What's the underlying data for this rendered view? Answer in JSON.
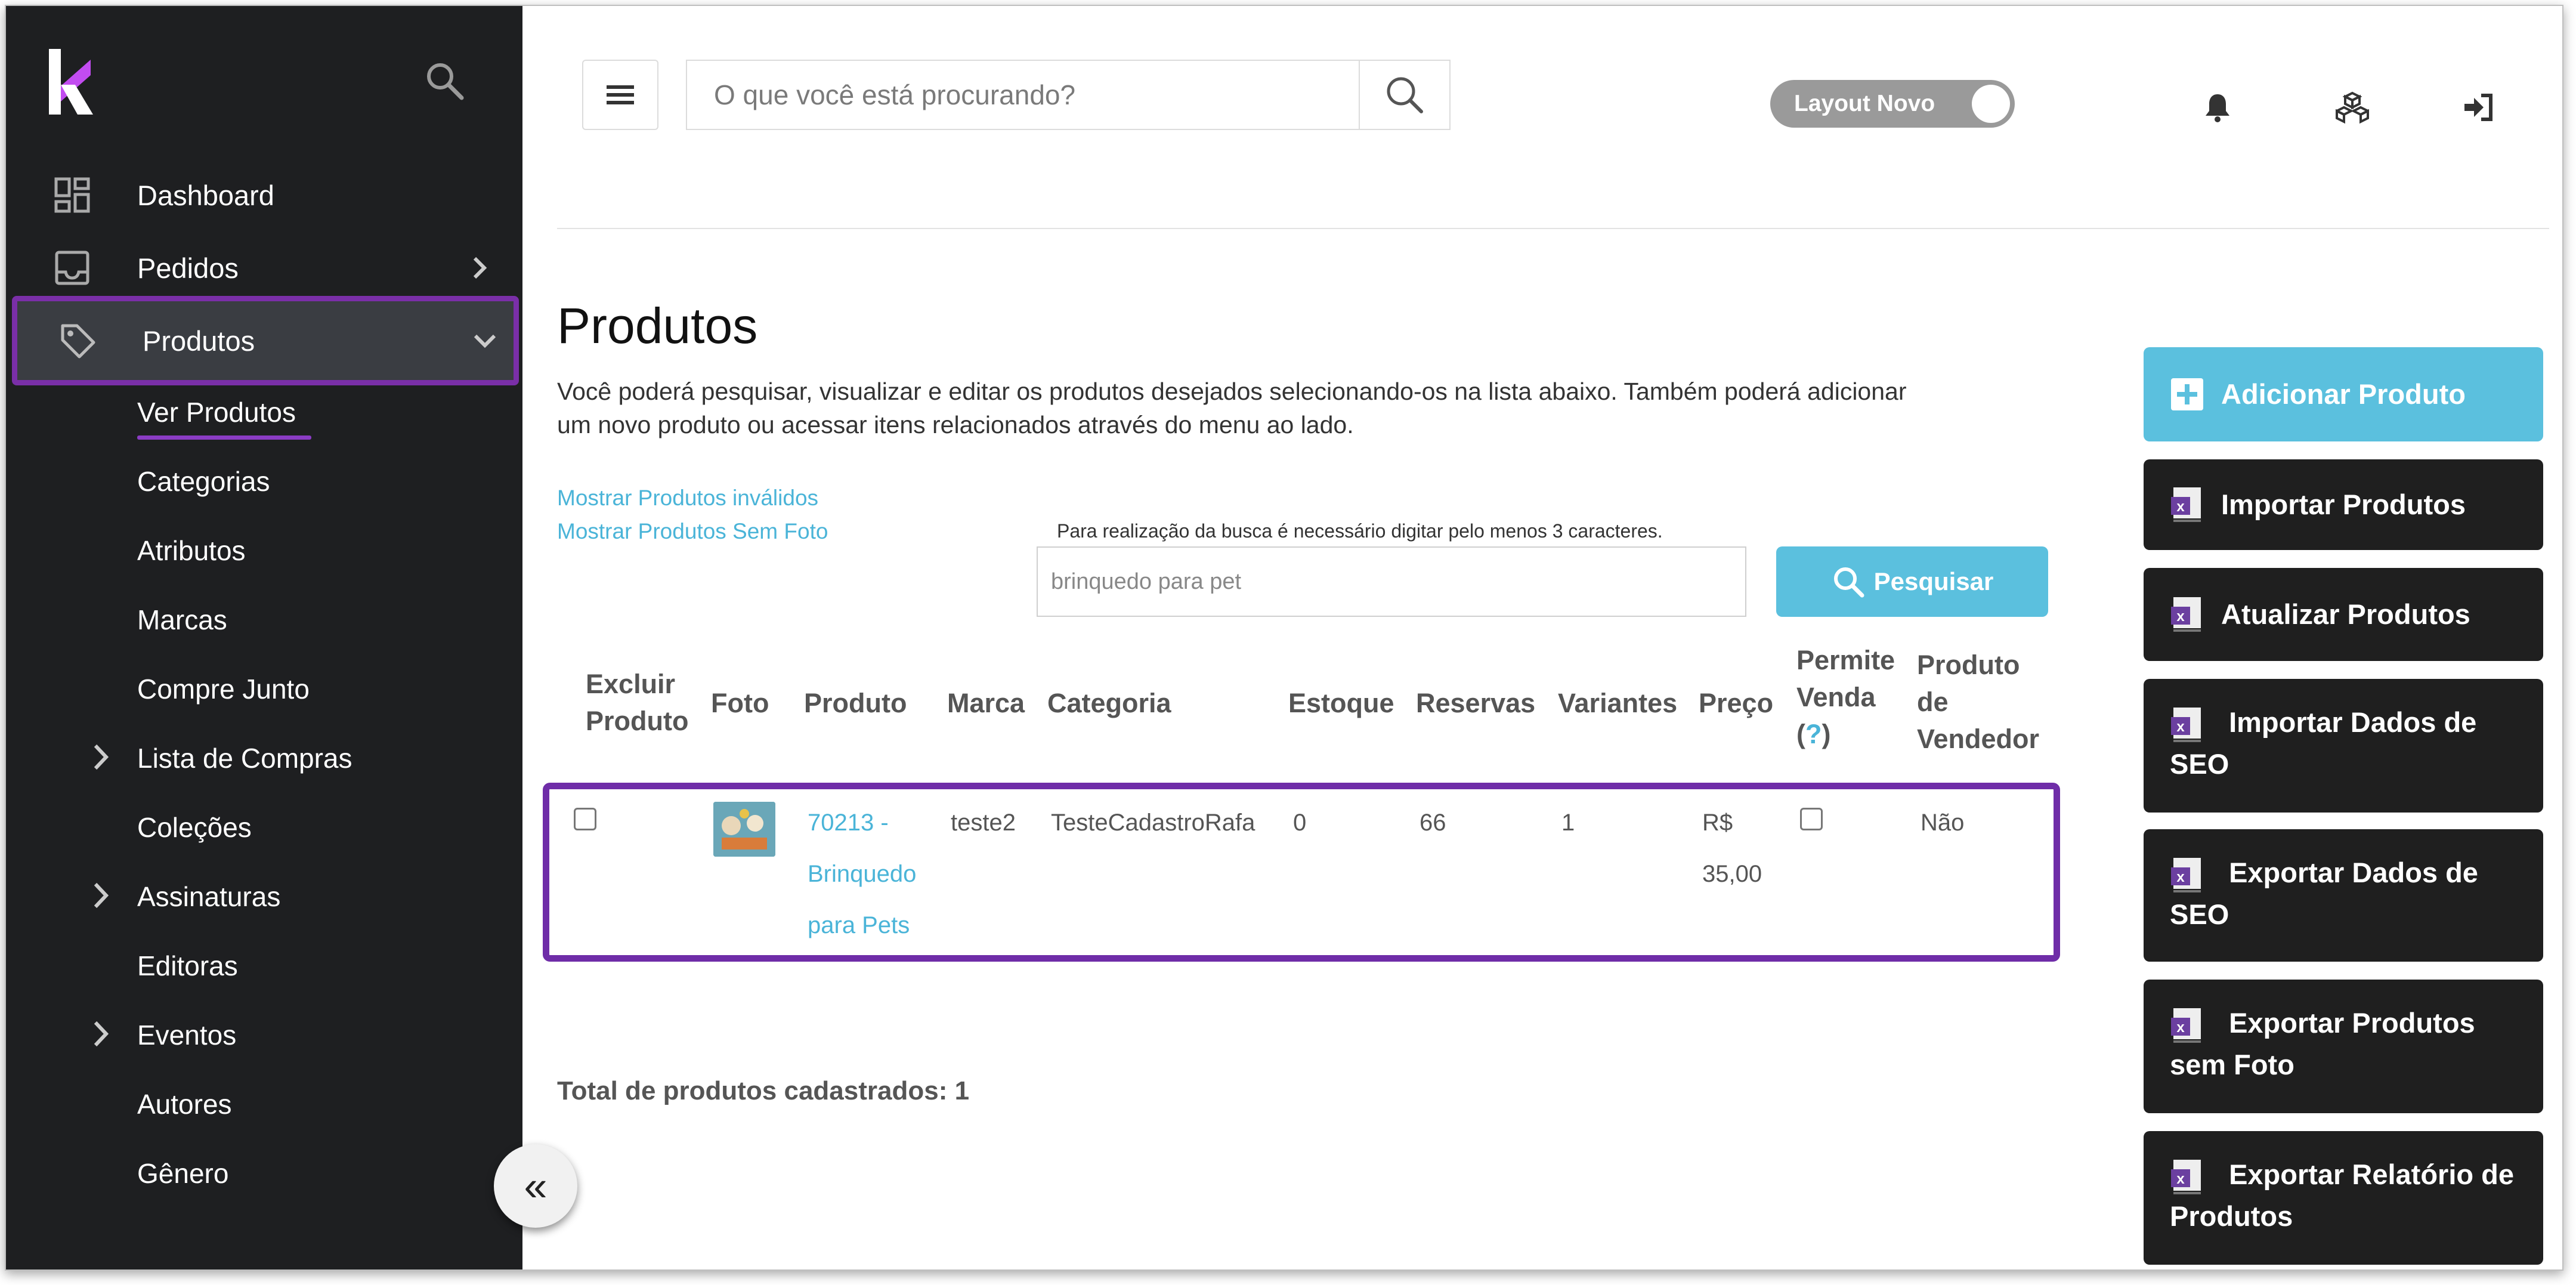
{
  "sidebar": {
    "items": [
      {
        "label": "Dashboard"
      },
      {
        "label": "Pedidos"
      },
      {
        "label": "Produtos"
      }
    ],
    "subitems": [
      {
        "label": "Ver Produtos"
      },
      {
        "label": "Categorias"
      },
      {
        "label": "Atributos"
      },
      {
        "label": "Marcas"
      },
      {
        "label": "Compre Junto"
      },
      {
        "label": "Lista de Compras"
      },
      {
        "label": "Coleções"
      },
      {
        "label": "Assinaturas"
      },
      {
        "label": "Editoras"
      },
      {
        "label": "Eventos"
      },
      {
        "label": "Autores"
      },
      {
        "label": "Gênero"
      }
    ],
    "collapse_label": "«"
  },
  "header": {
    "search_placeholder": "O que você está procurando?",
    "toggle_label": "Layout Novo"
  },
  "main": {
    "title": "Produtos",
    "description": "Você poderá pesquisar, visualizar e editar os produtos desejados selecionando-os na lista abaixo. Também poderá adicionar um novo produto ou acessar itens relacionados através do menu ao lado.",
    "link_invalid": "Mostrar Produtos inválidos",
    "link_no_photo": "Mostrar Produtos Sem Foto",
    "search_hint": "Para realização da busca é necessário digitar pelo menos 3 caracteres.",
    "search_value": "brinquedo para pet",
    "search_button": "Pesquisar",
    "table": {
      "headers": {
        "delete": [
          "Excluir",
          "Produto"
        ],
        "photo": "Foto",
        "product": "Produto",
        "brand": "Marca",
        "category": "Categoria",
        "stock": "Estoque",
        "reservations": "Reservas",
        "variants": "Variantes",
        "price": "Preço",
        "allow_sale": [
          "Permite",
          "Venda",
          "(",
          "?",
          ")"
        ],
        "seller_product": [
          "Produto",
          "de",
          "Vendedor"
        ]
      },
      "row": {
        "product_lines": [
          "70213 -",
          "Brinquedo",
          "para Pets"
        ],
        "brand": "teste2",
        "category": "TesteCadastroRafa",
        "stock": "0",
        "reservations": "66",
        "variants": "1",
        "price_lines": [
          "R$",
          "35,00"
        ],
        "seller_product": "Não"
      }
    },
    "total": "Total de produtos cadastrados: 1"
  },
  "actions": [
    {
      "lines": [
        "Adicionar Produto"
      ]
    },
    {
      "lines": [
        "Importar Produtos"
      ]
    },
    {
      "lines": [
        "Atualizar Produtos"
      ]
    },
    {
      "lines": [
        "Importar Dados de",
        "SEO"
      ]
    },
    {
      "lines": [
        "Exportar Dados de",
        "SEO"
      ]
    },
    {
      "lines": [
        "Exportar Produtos",
        "sem Foto"
      ]
    },
    {
      "lines": [
        "Exportar Relatório de",
        "Produtos"
      ]
    }
  ],
  "colors": {
    "sidebar_bg": "#1e1f21",
    "highlight": "#6f2da8",
    "accent": "#5bc0de",
    "action_bg": "#1f1f1f"
  }
}
